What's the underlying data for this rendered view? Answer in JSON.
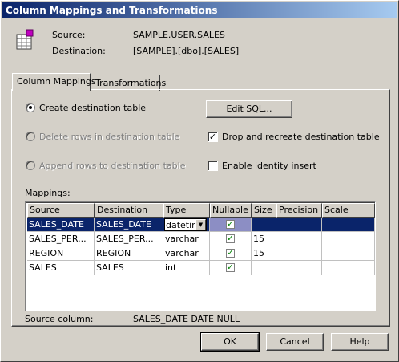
{
  "window": {
    "title": "Column Mappings and Transformations"
  },
  "header": {
    "source_label": "Source:",
    "source_value": "SAMPLE.USER.SALES",
    "destination_label": "Destination:",
    "destination_value": "[SAMPLE].[dbo].[SALES]"
  },
  "tabs": [
    {
      "label": "Column Mappings",
      "active": true
    },
    {
      "label": "Transformations",
      "active": false
    }
  ],
  "options": {
    "create_dest_table": {
      "label": "Create destination table",
      "checked": true,
      "enabled": true
    },
    "delete_rows": {
      "label": "Delete rows in destination table",
      "checked": false,
      "enabled": false
    },
    "append_rows": {
      "label": "Append rows to destination table",
      "checked": false,
      "enabled": false
    },
    "edit_sql_label": "Edit SQL...",
    "drop_recreate": {
      "label": "Drop and recreate destination table",
      "checked": true
    },
    "identity_insert": {
      "label": "Enable identity insert",
      "checked": false
    }
  },
  "mappings": {
    "label": "Mappings:",
    "columns": [
      "Source",
      "Destination",
      "Type",
      "Nullable",
      "Size",
      "Precision",
      "Scale"
    ],
    "rows": [
      {
        "source": "SALES_DATE",
        "destination": "SALES_DATE",
        "type": "datetime",
        "nullable": true,
        "size": "",
        "precision": "",
        "scale": "",
        "selected": true
      },
      {
        "source": "SALES_PER...",
        "destination": "SALES_PER...",
        "type": "varchar",
        "nullable": true,
        "size": "15",
        "precision": "",
        "scale": "",
        "selected": false
      },
      {
        "source": "REGION",
        "destination": "REGION",
        "type": "varchar",
        "nullable": true,
        "size": "15",
        "precision": "",
        "scale": "",
        "selected": false
      },
      {
        "source": "SALES",
        "destination": "SALES",
        "type": "int",
        "nullable": true,
        "size": "",
        "precision": "",
        "scale": "",
        "selected": false
      }
    ]
  },
  "source_column": {
    "label": "Source column:",
    "value": "SALES_DATE DATE NULL"
  },
  "buttons": {
    "ok": "OK",
    "cancel": "Cancel",
    "help": "Help"
  },
  "icons": {
    "table": "table-icon",
    "checkmark": "checkmark-icon",
    "dropdown": "chevron-down-icon"
  },
  "colors": {
    "title_start": "#0a246a",
    "title_end": "#a6caf0",
    "selection": "#0a246a",
    "check_green": "#008000"
  }
}
